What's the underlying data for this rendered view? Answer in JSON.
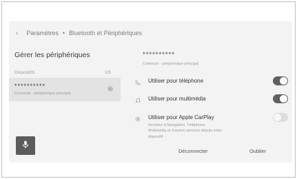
{
  "breadcrumb": {
    "parent": "Paramètres",
    "separator": "•",
    "current": "Bluetooth et Périphériques"
  },
  "left_panel": {
    "title": "Gérer les périphériques",
    "section_label": "Dispositifs",
    "count": "1/5",
    "device": {
      "name": "**********",
      "status": "Connecté - périphérique principal"
    }
  },
  "right_panel": {
    "device_name": "**********",
    "device_status": "Connecté - périphérique principal",
    "options": [
      {
        "label": "Utiliser pour téléphone",
        "icon": "phone-icon",
        "enabled": true
      },
      {
        "label": "Utiliser pour multimédia",
        "icon": "music-note-icon",
        "enabled": true
      },
      {
        "label": "Utiliser pour Apple CarPlay",
        "icon": "carplay-icon",
        "enabled": false
      }
    ],
    "carplay_description": "Accédez à Navigation, Téléphone, Multimédia et d'autres services depuis votre dispositif",
    "actions": {
      "disconnect": "Déconnecter",
      "forget": "Oublier"
    }
  },
  "voice_button": {
    "icon": "microphone-icon"
  },
  "colors": {
    "screen_bg": "#f3f3f3",
    "selected_row": "#e3e3e3",
    "toggle_on": "#5f5f5f",
    "toggle_off": "#dddddd",
    "mic_button": "#5b5b5b"
  }
}
